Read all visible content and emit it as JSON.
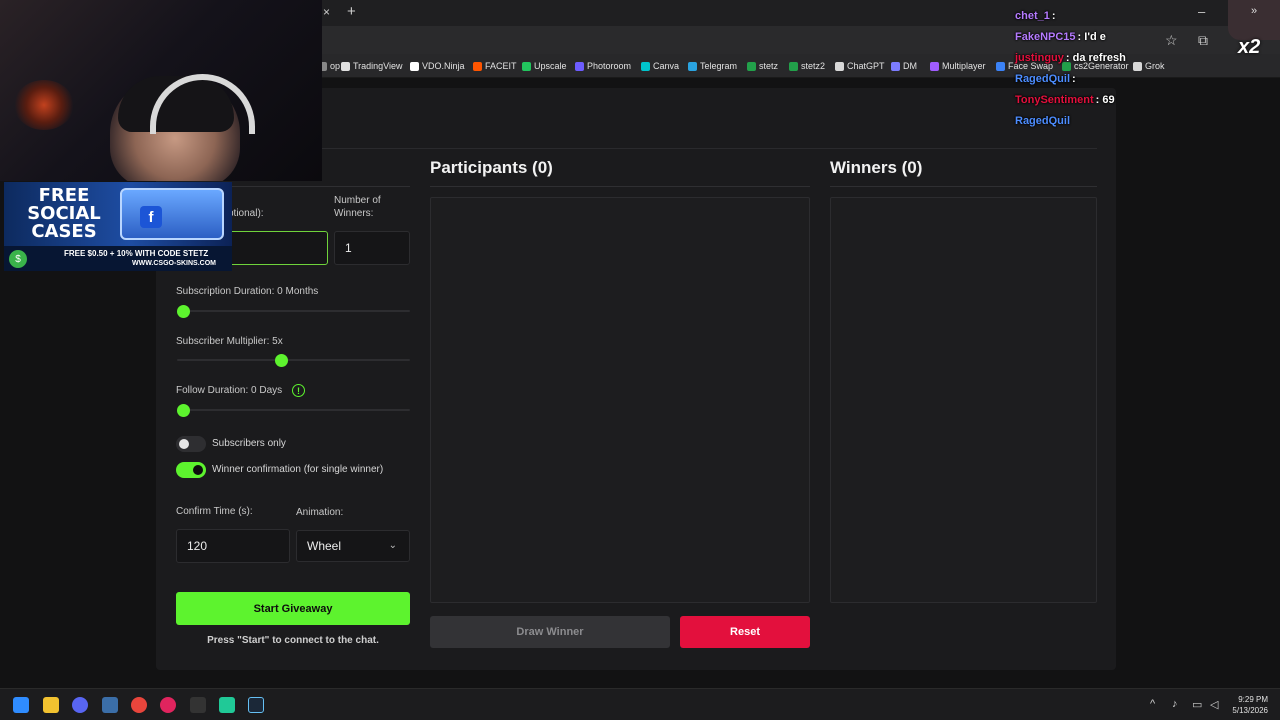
{
  "browser": {
    "new_tab_glyph": "+",
    "close_tab_glyph": "×",
    "minimize_glyph": "–",
    "bookmarks": [
      {
        "label": "op",
        "color": "#888888"
      },
      {
        "label": "TradingView",
        "color": "#e0e0e0"
      },
      {
        "label": "VDO.Ninja",
        "color": "#ffffff"
      },
      {
        "label": "FACEIT",
        "color": "#ff5500"
      },
      {
        "label": "Upscale",
        "color": "#22c55e"
      },
      {
        "label": "Photoroom",
        "color": "#6d5cff"
      },
      {
        "label": "Canva",
        "color": "#00c4cc"
      },
      {
        "label": "Telegram",
        "color": "#2aa3e0"
      },
      {
        "label": "stetz",
        "color": "#22a04a"
      },
      {
        "label": "stetz2",
        "color": "#22a04a"
      },
      {
        "label": "ChatGPT",
        "color": "#d8d8d8"
      },
      {
        "label": "DM",
        "color": "#7c7cff"
      },
      {
        "label": "Multiplayer",
        "color": "#a05cff"
      },
      {
        "label": "Face Swap",
        "color": "#3b82f6"
      },
      {
        "label": "cs2Generator",
        "color": "#22a04a"
      },
      {
        "label": "Grok",
        "color": "#d8d8d8"
      }
    ],
    "more_glyph": "»"
  },
  "giveaway": {
    "participants_title": "Participants (0)",
    "winners_title": "Winners (0)",
    "keyword_label": "ptional):",
    "winners_count_label_1": "Number of",
    "winners_count_label_2": "Winners:",
    "winners_count_value": "1",
    "keyword_value": "",
    "sub_duration_label": "Subscription Duration: 0 Months",
    "sub_duration_value": 0,
    "sub_multiplier_label": "Subscriber Multiplier: 5x",
    "sub_multiplier_fraction": 0.45,
    "follow_duration_label": "Follow Duration:  0  Days",
    "follow_duration_value": 0,
    "info_glyph": "!",
    "subscribers_only_label": "Subscribers only",
    "subscribers_only": false,
    "winner_confirmation_label": "Winner confirmation (for single winner)",
    "winner_confirmation": true,
    "confirm_time_label": "Confirm Time (s):",
    "confirm_time_value": "120",
    "animation_label": "Animation:",
    "animation_value": "Wheel",
    "start_button": "Start Giveaway",
    "start_hint": "Press \"Start\" to connect to the chat.",
    "draw_button": "Draw Winner",
    "reset_button": "Reset"
  },
  "ad": {
    "title_line1": "FREE",
    "title_line2": "SOCIAL",
    "title_line3": "CASES",
    "promo": "FREE $0.50 + 10% WITH CODE STETZ",
    "site": "WWW.CSGO-SKINS.COM"
  },
  "chat": {
    "messages": [
      {
        "user": "chet_1",
        "text": " :",
        "color": "#b57bff"
      },
      {
        "user": "FakeNPC15",
        "text": " : I'd e",
        "color": "#b57bff"
      },
      {
        "user": "justinguy",
        "text": " : da refresh",
        "color": "#e3103d"
      },
      {
        "user": "RagedQuil",
        "text": " :",
        "color": "#4d8dff"
      },
      {
        "user": "TonySentiment",
        "text": " : 69",
        "color": "#e3103d"
      },
      {
        "user": "RagedQuil",
        "text": " ",
        "color": "#4d8dff"
      }
    ],
    "badge": "x2"
  },
  "taskbar": {
    "time": "9:29 PM",
    "date": "5/13/2026"
  }
}
